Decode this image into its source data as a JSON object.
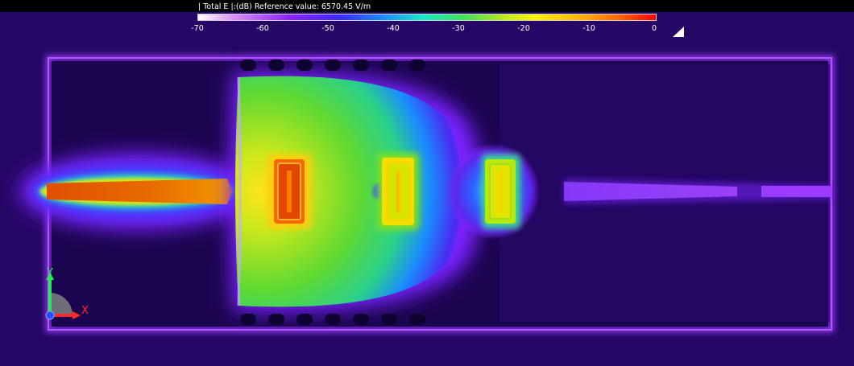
{
  "colorbar": {
    "title": "| Total E |:(dB) Reference value: 6570.45 V/m",
    "ticks": [
      "-70",
      "-60",
      "-50",
      "-40",
      "-30",
      "-20",
      "-10",
      "0"
    ]
  },
  "axes": {
    "y_label": "Y",
    "x_label": "X",
    "y_color": "#2ee65a",
    "x_color": "#ff2a2a"
  },
  "icons": {
    "corner": "triangle-corner-icon",
    "axes": "axes-triad-icon"
  }
}
